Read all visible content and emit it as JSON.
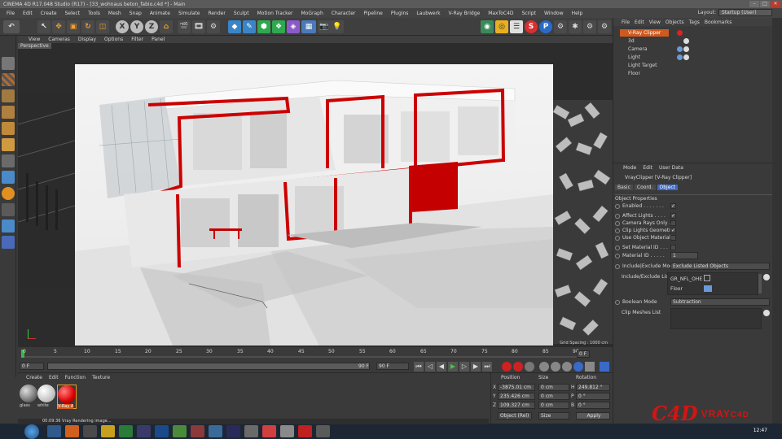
{
  "title": "CINEMA 4D R17.048 Studio (R17) - [33_wohnaus beton_fabio.c4d *] - Main",
  "menu": [
    "File",
    "Edit",
    "Create",
    "Select",
    "Tools",
    "Mesh",
    "Snap",
    "Animate",
    "Simulate",
    "Render",
    "Sculpt",
    "Motion Tracker",
    "MoGraph",
    "Character",
    "Pipeline",
    "Plugins",
    "Laubwerk",
    "V-Ray Bridge",
    "MaxToC4D",
    "Script",
    "Window",
    "Help"
  ],
  "layout": {
    "label": "Layout:",
    "value": "Startup (User)"
  },
  "viewport": {
    "menu": [
      "View",
      "Cameras",
      "Display",
      "Options",
      "Filter",
      "Panel"
    ],
    "label": "Perspective",
    "grid_readout": "Grid Spacing : 1000 cm"
  },
  "timeline": {
    "ticks": [
      "0",
      "5",
      "10",
      "15",
      "20",
      "25",
      "30",
      "35",
      "40",
      "45",
      "50",
      "55",
      "60",
      "65",
      "70",
      "75",
      "80",
      "85",
      "90"
    ],
    "current": "0 F",
    "start": "0 F",
    "end": "90 F",
    "end2": "90 F",
    "frame_display": "0 F"
  },
  "materials": {
    "menu": [
      "Create",
      "Edit",
      "Function",
      "Texture"
    ],
    "items": [
      {
        "name": "glass"
      },
      {
        "name": "white"
      },
      {
        "name": "V-Ray A"
      }
    ]
  },
  "coordinates": {
    "headers": [
      "Position",
      "Size",
      "Rotation"
    ],
    "rows": [
      {
        "axis": "X",
        "pos": "-3875.01 cm",
        "size": "0 cm",
        "rot_label": "H",
        "rot": "249.812 °"
      },
      {
        "axis": "Y",
        "pos": "235.426 cm",
        "size": "0 cm",
        "rot_label": "P",
        "rot": "0 °"
      },
      {
        "axis": "Z",
        "pos": "109.327 cm",
        "size": "0 cm",
        "rot_label": "B",
        "rot": "0 °"
      }
    ],
    "mode": "Object (Rel)",
    "size_mode": "Size",
    "apply": "Apply"
  },
  "objects": {
    "menu": [
      "File",
      "Edit",
      "View",
      "Objects",
      "Tags",
      "Bookmarks"
    ],
    "items": [
      {
        "name": "V-Ray Clipper",
        "selected": true
      },
      {
        "name": "3d",
        "selected": false
      },
      {
        "name": "Camera",
        "selected": false
      },
      {
        "name": "Light",
        "selected": false
      },
      {
        "name": "Light Target",
        "selected": false
      },
      {
        "name": "Floor",
        "selected": false
      }
    ]
  },
  "attributes": {
    "menu": [
      "Mode",
      "Edit",
      "User Data"
    ],
    "object_title": "VrayClipper [V-Ray Clipper]",
    "tabs": [
      "Basic",
      "Coord.",
      "Object"
    ],
    "active_tab": "Object",
    "section": "Object Properties",
    "props": [
      {
        "label": "Enabled . . . . . . .",
        "checked": true
      },
      {
        "label": "Affect Lights . . . .",
        "checked": true
      },
      {
        "label": "Camera Rays Only .",
        "checked": false
      },
      {
        "label": "Clip Lights Geometry",
        "checked": true
      },
      {
        "label": "Use Object Material .",
        "checked": false
      },
      {
        "label": "Set Material ID . . .",
        "checked": false
      }
    ],
    "material_id": {
      "label": "Material ID . . . . .",
      "value": "1"
    },
    "include_mode": {
      "label": "Include|Exclude Mode",
      "value": "Exclude Listed Objects"
    },
    "include_list": {
      "label": "Include/Exclude List",
      "items": [
        "GR_NFL_OHE",
        "Floor"
      ]
    },
    "boolean_mode": {
      "label": "Boolean Mode",
      "value": "Subtraction"
    },
    "clip_meshes": {
      "label": "Clip Meshes List"
    }
  },
  "status": "00:09:36 Vray Rendering image...",
  "clock": "12:47",
  "brand": {
    "mark": "C4D",
    "word": "VRAY",
    "suffix": "C4D"
  }
}
